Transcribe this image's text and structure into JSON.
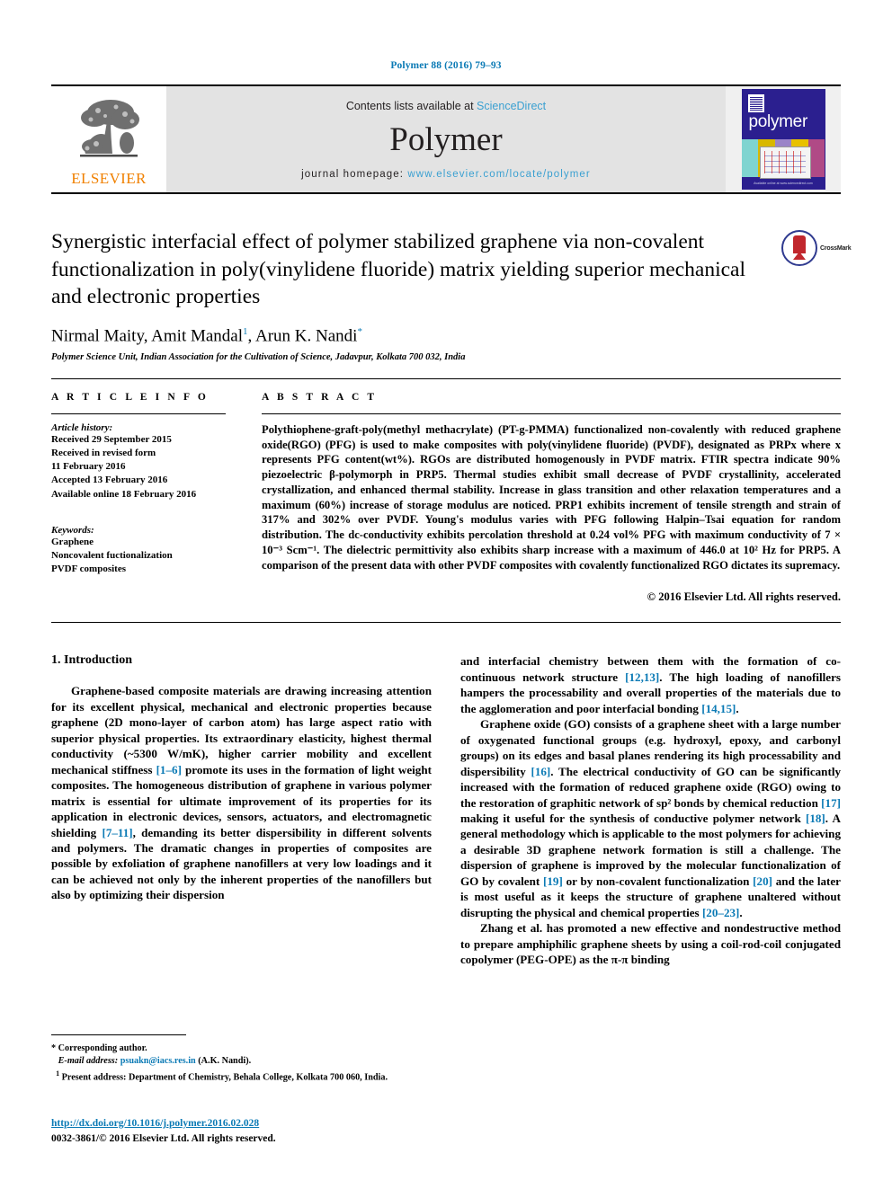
{
  "running_head": "Polymer 88 (2016) 79–93",
  "masthead": {
    "publisher_name": "ELSEVIER",
    "contents_prefix": "Contents lists available at ",
    "contents_link": "ScienceDirect",
    "journal_name": "Polymer",
    "homepage_prefix": "journal homepage: ",
    "homepage_url": "www.elsevier.com/locate/polymer",
    "cover_title": "polymer",
    "cover_footer": "Available online at www.sciencedirect.com"
  },
  "article": {
    "title": "Synergistic interfacial effect of polymer stabilized graphene via non-covalent functionalization in poly(vinylidene fluoride) matrix yielding superior mechanical and electronic properties",
    "crossmark_label": "CrossMark",
    "authors_text": "Nirmal Maity, Amit Mandal",
    "author_marker_1": "1",
    "authors_text_2": ", Arun K. Nandi",
    "author_marker_2": "*",
    "affiliation": "Polymer Science Unit, Indian Association for the Cultivation of Science, Jadavpur, Kolkata 700 032, India"
  },
  "article_info": {
    "heading": "A R T I C L E   I N F O",
    "history_label": "Article history:",
    "history": [
      "Received 29 September 2015",
      "Received in revised form",
      "11 February 2016",
      "Accepted 13 February 2016",
      "Available online 18 February 2016"
    ],
    "keywords_label": "Keywords:",
    "keywords": [
      "Graphene",
      "Noncovalent fuctionalization",
      "PVDF composites"
    ]
  },
  "abstract": {
    "heading": "A B S T R A C T",
    "text": "Polythiophene-graft-poly(methyl methacrylate) (PT-g-PMMA) functionalized non-covalently with reduced graphene oxide(RGO) (PFG) is used to make composites with poly(vinylidene fluoride) (PVDF), designated as PRPx where x represents PFG content(wt%). RGOs are distributed homogenously in PVDF matrix. FTIR spectra indicate 90% piezoelectric β-polymorph in PRP5. Thermal studies exhibit small decrease of PVDF crystallinity, accelerated crystallization, and enhanced thermal stability. Increase in glass transition and other relaxation temperatures and a maximum (60%) increase of storage modulus are noticed. PRP1 exhibits increment of tensile strength and strain of 317% and 302% over PVDF. Young's modulus varies with PFG following Halpin–Tsai equation for random distribution. The dc-conductivity exhibits percolation threshold at 0.24 vol% PFG with maximum conductivity of 7 × 10⁻³ Scm⁻¹. The dielectric permittivity also exhibits sharp increase with a maximum of 446.0 at 10² Hz for PRP5. A comparison of the present data with other PVDF composites with covalently functionalized RGO dictates its supremacy.",
    "copyright": "© 2016 Elsevier Ltd. All rights reserved."
  },
  "introduction": {
    "heading": "1. Introduction",
    "left_paragraphs": [
      "Graphene-based composite materials are drawing increasing attention for its excellent physical, mechanical and electronic properties because graphene (2D mono-layer of carbon atom) has large aspect ratio with superior physical properties. Its extraordinary elasticity, highest thermal conductivity (~5300 W/mK), higher carrier mobility and excellent mechanical stiffness [1–6] promote its uses in the formation of light weight composites. The homogeneous distribution of graphene in various polymer matrix is essential for ultimate improvement of its properties for its application in electronic devices, sensors, actuators, and electromagnetic shielding [7–11], demanding its better dispersibility in different solvents and polymers. The dramatic changes in properties of composites are possible by exfoliation of graphene nanofillers at very low loadings and it can be achieved not only by the inherent properties of the nanofillers but also by optimizing their dispersion"
    ],
    "right_paragraphs": [
      "and interfacial chemistry between them with the formation of co-continuous network structure [12,13]. The high loading of nanofillers hampers the processability and overall properties of the materials due to the agglomeration and poor interfacial bonding [14,15].",
      "Graphene oxide (GO) consists of a graphene sheet with a large number of oxygenated functional groups (e.g. hydroxyl, epoxy, and carbonyl groups) on its edges and basal planes rendering its high processability and dispersibility [16]. The electrical conductivity of GO can be significantly increased with the formation of reduced graphene oxide (RGO) owing to the restoration of graphitic network of sp² bonds by chemical reduction [17] making it useful for the synthesis of conductive polymer network [18]. A general methodology which is applicable to the most polymers for achieving a desirable 3D graphene network formation is still a challenge. The dispersion of graphene is improved by the molecular functionalization of GO by covalent [19] or by non-covalent functionalization [20] and the later is most useful as it keeps the structure of graphene unaltered without disrupting the physical and chemical properties [20–23].",
      "Zhang et al. has promoted a new effective and nondestructive method to prepare amphiphilic graphene sheets by using a coil-rod-coil conjugated copolymer (PEG-OPE) as the π-π binding"
    ]
  },
  "footnotes": {
    "corresponding": "* Corresponding author.",
    "email_label": "E-mail address:",
    "email": "psuakn@iacs.res.in",
    "email_suffix": "(A.K. Nandi).",
    "present_marker": "1",
    "present_address": "Present address: Department of Chemistry, Behala College, Kolkata 700 060, India.",
    "doi": "http://dx.doi.org/10.1016/j.polymer.2016.02.028",
    "issn": "0032-3861/© 2016 Elsevier Ltd. All rights reserved."
  },
  "colors": {
    "link_blue": "#0b7ab5",
    "sd_blue": "#3aa0d1",
    "elsevier_orange": "#f08000",
    "cover_navy": "#2b1f8f"
  }
}
